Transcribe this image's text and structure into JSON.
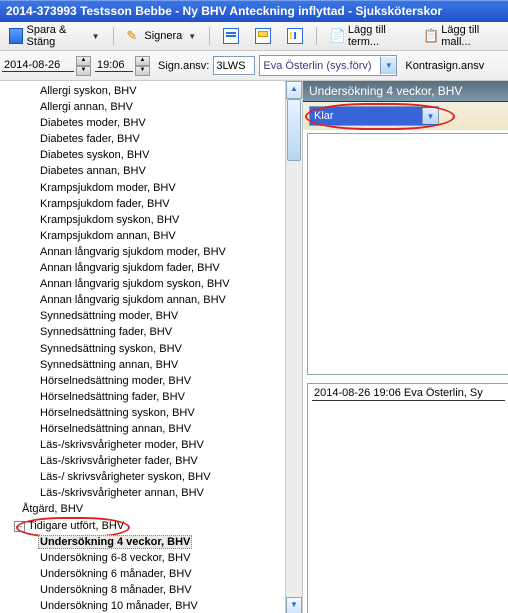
{
  "window_title": "2014-373993 Testsson Bebbe - Ny BHV Anteckning inflyttad - Sjuksköterskor",
  "toolbar": {
    "save_close": "Spara & Stäng",
    "sign": "Signera",
    "add_term": "Lägg till term...",
    "add_template": "Lägg till mall..."
  },
  "fields": {
    "date": "2014-08-26",
    "time": "19:06",
    "sign_ansv_label": "Sign.ansv:",
    "code": "3LWS",
    "name": "Eva Österlin (sys.förv)",
    "kontra_label": "Kontrasign.ansv"
  },
  "tree": {
    "items_l2": [
      "Allergi syskon, BHV",
      "Allergi annan, BHV",
      "Diabetes moder, BHV",
      "Diabetes fader, BHV",
      "Diabetes syskon, BHV",
      "Diabetes annan, BHV",
      "Krampsjukdom moder, BHV",
      "Krampsjukdom fader, BHV",
      "Krampsjukdom syskon, BHV",
      "Krampsjukdom annan, BHV",
      "Annan långvarig sjukdom moder, BHV",
      "Annan långvarig sjukdom fader, BHV",
      "Annan långvarig sjukdom syskon, BHV",
      "Annan långvarig sjukdom annan, BHV",
      "Synnedsättning moder, BHV",
      "Synnedsättning fader, BHV",
      "Synnedsättning syskon, BHV",
      "Synnedsättning annan, BHV",
      "Hörselnedsättning moder, BHV",
      "Hörselnedsättning fader, BHV",
      "Hörselnedsättning syskon, BHV",
      "Hörselnedsättning annan, BHV",
      "Läs-/skrivsvårigheter moder, BHV",
      "Läs-/skrivsvårigheter fader, BHV",
      "Läs-/ skrivsvårigheter syskon, BHV",
      "Läs-/skrivsvårigheter annan, BHV"
    ],
    "item_l0": "Åtgärd, BHV",
    "item_l1_tidigare": "Tidigare utfört, BHV",
    "items_l2_b": [
      "Undersökning 4 veckor, BHV",
      "Undersökning 6-8 veckor, BHV",
      "Undersökning 6 månader, BHV",
      "Undersökning 8 månader, BHV",
      "Undersökning 10 månader, BHV"
    ]
  },
  "right": {
    "header": "Undersökning 4 veckor, BHV",
    "status_value": "Klar",
    "entry_line": "2014-08-26 19:06   Eva Österlin, Sy"
  }
}
